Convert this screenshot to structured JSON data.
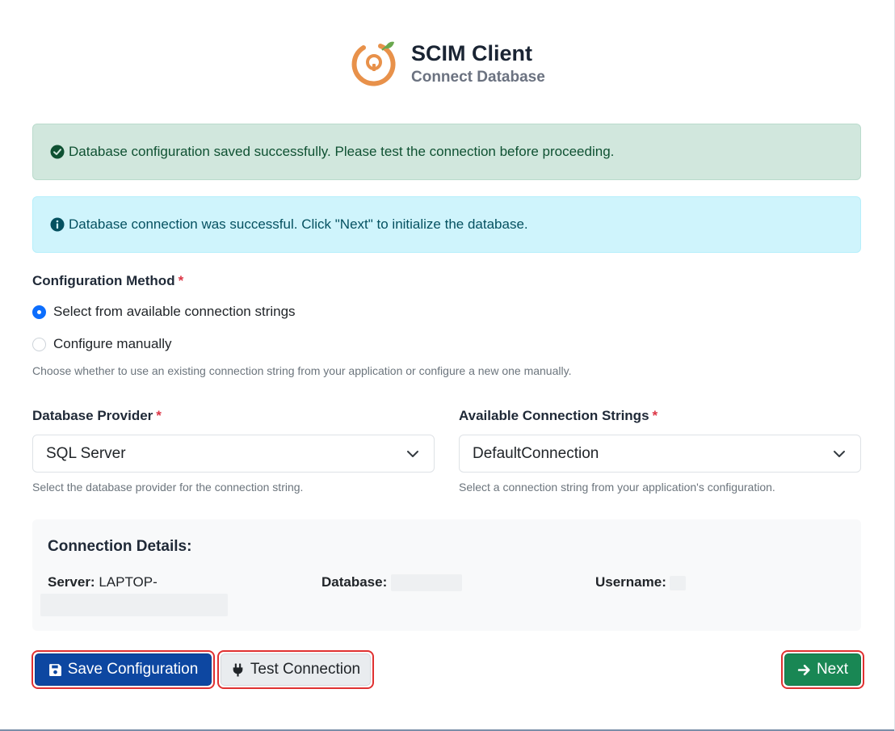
{
  "header": {
    "title": "SCIM Client",
    "subtitle": "Connect Database"
  },
  "alerts": {
    "success": "Database configuration saved successfully. Please test the connection before proceeding.",
    "info": "Database connection was successful. Click \"Next\" to initialize the database."
  },
  "config_method": {
    "label": "Configuration Method",
    "required_mark": "*",
    "options": [
      {
        "label": "Select from available connection strings",
        "checked": true
      },
      {
        "label": "Configure manually",
        "checked": false
      }
    ],
    "help": "Choose whether to use an existing connection string from your application or configure a new one manually."
  },
  "provider": {
    "label": "Database Provider",
    "required_mark": "*",
    "value": "SQL Server",
    "help": "Select the database provider for the connection string."
  },
  "connection_strings": {
    "label": "Available Connection Strings",
    "required_mark": "*",
    "value": "DefaultConnection",
    "help": "Select a connection string from your application's configuration."
  },
  "details": {
    "title": "Connection Details:",
    "server_label": "Server:",
    "server_value": "LAPTOP-",
    "database_label": "Database:",
    "username_label": "Username:"
  },
  "buttons": {
    "save": "Save Configuration",
    "test": "Test Connection",
    "next": "Next"
  },
  "colors": {
    "primary": "#0d47a1",
    "success": "#198754",
    "highlight_border": "#e03131",
    "logo_orange": "#e8914a",
    "logo_green": "#6aa84f"
  }
}
